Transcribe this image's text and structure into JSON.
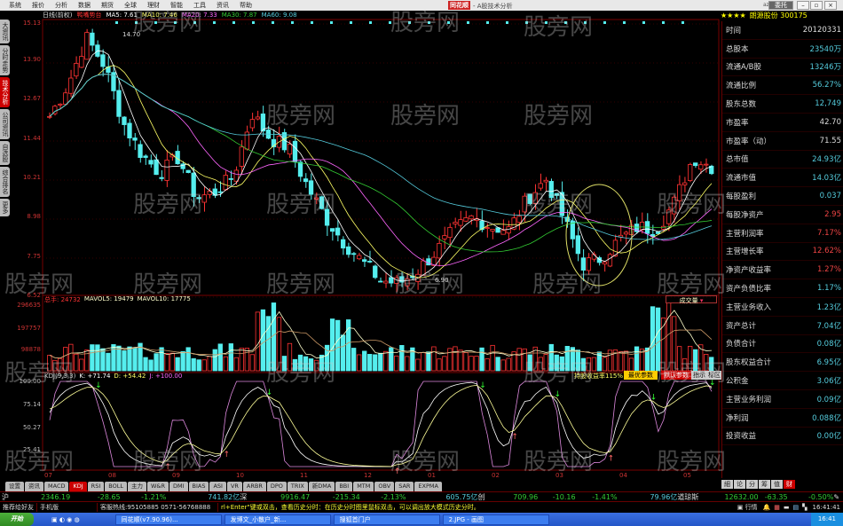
{
  "menu": [
    "系统",
    "报价",
    "分析",
    "数据",
    "期货",
    "全球",
    "理财",
    "智能",
    "工具",
    "资讯",
    "帮助"
  ],
  "app": {
    "brand": "同花顺",
    "subtitle": "- A股技术分析",
    "user": "azie99",
    "window_btn": "委托"
  },
  "chart_title": {
    "period": "日线(前权)",
    "tag": "鸭嘴势台",
    "ma5": "MA5: 7.61",
    "ma10": "MA10: 7.46",
    "ma20": "MA20: 7.33",
    "ma30": "MA30: 7.87",
    "ma60": "MA60: 9.08"
  },
  "stock": {
    "stars": "★★★★",
    "name": "朗源股份 300175"
  },
  "sidebar": [
    "大资讯",
    "分时走势",
    "技术分析",
    "公司资讯",
    "自选股",
    "综合排名",
    "更多"
  ],
  "price_axis": [
    "15.13",
    "13.90",
    "12.67",
    "11.44",
    "10.21",
    "8.98",
    "7.75",
    "6.52"
  ],
  "price_marks": {
    "high": "14.70",
    "low": "6.90"
  },
  "volume": {
    "label": "总手: 24732",
    "mavol5": "MAVOL5: 19479",
    "mavol10": "MAVOL10: 17775",
    "axis": [
      "296635",
      "197757",
      "98878"
    ],
    "selector": "成交量"
  },
  "kdj": {
    "label": "KDJ(9,3,3)",
    "k": "K: +71.74",
    "d": "D: +54.42",
    "j": "J: +100.00",
    "axis": [
      "100.00",
      "75.14",
      "50.27",
      "25.41"
    ],
    "yield": "持股收益率115%",
    "btn_opt": "最优参数",
    "btn_default": "默认参数",
    "btn_sig": "指示",
    "btn_zone": "标区"
  },
  "dates": [
    "07",
    "08",
    "09",
    "10",
    "11",
    "12",
    "01",
    "02",
    "03",
    "04",
    "05"
  ],
  "tabs": [
    "设置",
    "资讯",
    "MACD",
    "KDJ",
    "RSI",
    "BOLL",
    "主力",
    "W&R",
    "DMI",
    "BIAS",
    "ASI",
    "VR",
    "ARBR",
    "DPO",
    "TRIX",
    "新DMA",
    "BBI",
    "MTM",
    "OBV",
    "SAR",
    "EXPMA"
  ],
  "right_panel": [
    {
      "k": "时间",
      "v": "20120331",
      "c": "#ddd"
    },
    {
      "k": "总股本",
      "v": "23540万",
      "c": "#5cd"
    },
    {
      "k": "流通A/B股",
      "v": "13246万",
      "c": "#5cd"
    },
    {
      "k": "流通比例",
      "v": "56.27%",
      "c": "#5cd"
    },
    {
      "k": "股东总数",
      "v": "12,749",
      "c": "#5cd"
    },
    {
      "k": "市盈率",
      "v": "42.70",
      "c": "#ddd"
    },
    {
      "k": "市盈率（动）",
      "v": "71.55",
      "c": "#ddd"
    },
    {
      "k": "总市值",
      "v": "24.93亿",
      "c": "#5cd"
    },
    {
      "k": "流通市值",
      "v": "14.03亿",
      "c": "#5cd"
    },
    {
      "k": "每股盈利",
      "v": "0.037",
      "c": "#5cd"
    },
    {
      "k": "每股净资产",
      "v": "2.95",
      "c": "#e44"
    },
    {
      "k": "主营利润率",
      "v": "7.17%",
      "c": "#e44"
    },
    {
      "k": "主营增长率",
      "v": "12.62%",
      "c": "#e44"
    },
    {
      "k": "净资产收益率",
      "v": "1.27%",
      "c": "#e44"
    },
    {
      "k": "资产负债比率",
      "v": "1.17%",
      "c": "#5cd"
    },
    {
      "k": "主营业务收入",
      "v": "1.23亿",
      "c": "#5cd"
    },
    {
      "k": "资产总计",
      "v": "7.04亿",
      "c": "#5cd"
    },
    {
      "k": "负债合计",
      "v": "0.08亿",
      "c": "#5cd"
    },
    {
      "k": "股东权益合计",
      "v": "6.95亿",
      "c": "#5cd"
    },
    {
      "k": "公积金",
      "v": "3.06亿",
      "c": "#5cd"
    },
    {
      "k": "主营业务利润",
      "v": "0.09亿",
      "c": "#5cd"
    },
    {
      "k": "净利润",
      "v": "0.088亿",
      "c": "#5cd"
    },
    {
      "k": "投资收益",
      "v": "0.00亿",
      "c": "#5cd"
    }
  ],
  "right_tabs": [
    "細",
    "论",
    "分",
    "筹",
    "值",
    "财"
  ],
  "index": {
    "sh_label": "沪",
    "sh": "2346.19",
    "sh_chg": "-28.65",
    "sh_pct": "-1.21%",
    "sh_amt": "741.82亿",
    "sz_label": "深",
    "sz": "9916.47",
    "sz_chg": "-215.34",
    "sz_pct": "-2.13%",
    "sz_amt": "605.75亿",
    "cy_label": "创",
    "cy": "709.96",
    "cy_chg": "-10.16",
    "cy_pct": "-1.41%",
    "cy_amt": "79.96亿",
    "dj_label": "道琼斯",
    "dj": "12632.00",
    "dj_chg": "-63.35",
    "dj_pct": "-0.50%"
  },
  "status": {
    "recommend": "推荐给好友",
    "mobile": "手机版",
    "hotline": "客服热线:95105885 0571-56768888",
    "tip": "rl+Enter\"键或双击，查看历史分时：在历史分时图里鼠标双击，可以调出放大模式历史分时。",
    "market": "行情",
    "clock": "16:41:41"
  },
  "taskbar": {
    "start": "开始",
    "tasks": [
      "同花顺(v7.90.96)...",
      "发博文_小散户_新...",
      "搜狐首门户",
      "2.JPG - 画图"
    ],
    "time": "16:41"
  },
  "watermark": "股旁网",
  "chart_data": {
    "type": "candlestick",
    "anchors": [
      12.2,
      13.2,
      14.7,
      13.8,
      12.0,
      11.0,
      10.4,
      10.9,
      9.6,
      9.8,
      10.3,
      12.3,
      11.5,
      11.2,
      10.0,
      9.0,
      8.2,
      7.6,
      7.0,
      6.9,
      7.3,
      7.9,
      8.6,
      9.0,
      8.7,
      8.6,
      9.6,
      10.2,
      8.9,
      7.5,
      7.7,
      8.3,
      8.7,
      8.6,
      9.5,
      10.9,
      10.6
    ],
    "ylim": [
      6.52,
      15.13
    ]
  }
}
